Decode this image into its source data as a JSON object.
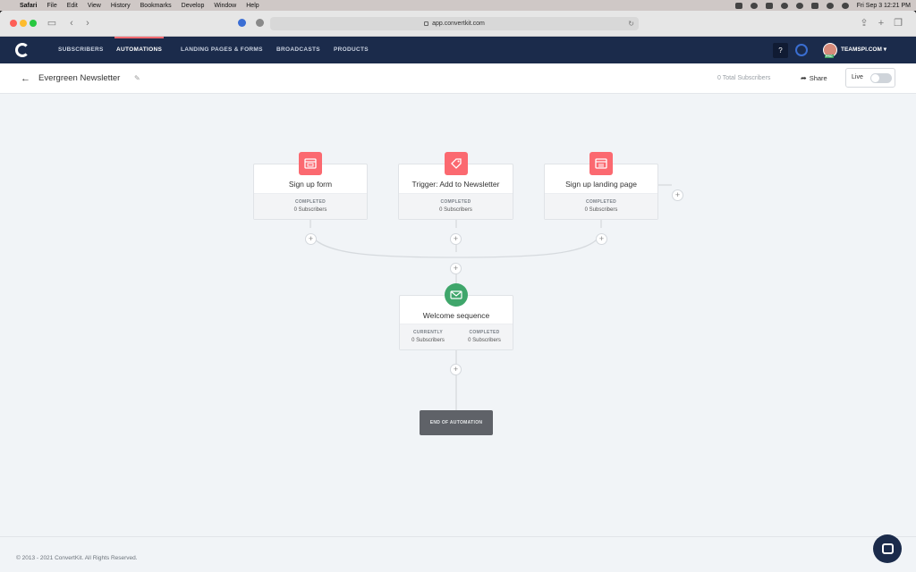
{
  "menubar": {
    "app": "Safari",
    "items": [
      "File",
      "Edit",
      "View",
      "History",
      "Bookmarks",
      "Develop",
      "Window",
      "Help"
    ],
    "clock": "Fri Sep 3  12:21 PM"
  },
  "browser": {
    "url": "app.convertkit.com"
  },
  "nav": {
    "items": [
      "SUBSCRIBERS",
      "AUTOMATIONS",
      "LANDING PAGES & FORMS",
      "BROADCASTS",
      "PRODUCTS"
    ],
    "active": "AUTOMATIONS",
    "help": "?",
    "account": "TEAMSPI.COM",
    "avatar_badge": "PRO"
  },
  "header": {
    "title": "Evergreen Newsletter",
    "total_subscribers": "0 Total Subscribers",
    "share": "Share",
    "live": "Live"
  },
  "workflow": {
    "entries": [
      {
        "name": "Sign up form",
        "status": "COMPLETED",
        "count": "0 Subscribers",
        "icon": "form-icon"
      },
      {
        "name": "Trigger: Add to Newsletter",
        "status": "COMPLETED",
        "count": "0 Subscribers",
        "icon": "tag-icon"
      },
      {
        "name": "Sign up landing page",
        "status": "COMPLETED",
        "count": "0 Subscribers",
        "icon": "landing-page-icon"
      }
    ],
    "sequence": {
      "name": "Welcome sequence",
      "icon": "envelope-icon",
      "stats": [
        {
          "label": "CURRENTLY",
          "value": "0 Subscribers"
        },
        {
          "label": "COMPLETED",
          "value": "0 Subscribers"
        }
      ]
    },
    "end": "END OF AUTOMATION",
    "plus": "+"
  },
  "footer": {
    "copyright": "© 2013 - 2021 ConvertKit. All Rights Reserved."
  },
  "colors": {
    "nav_bg": "#1b2b4b",
    "accent": "#fb6970",
    "sequence_green": "#3fa66b"
  }
}
